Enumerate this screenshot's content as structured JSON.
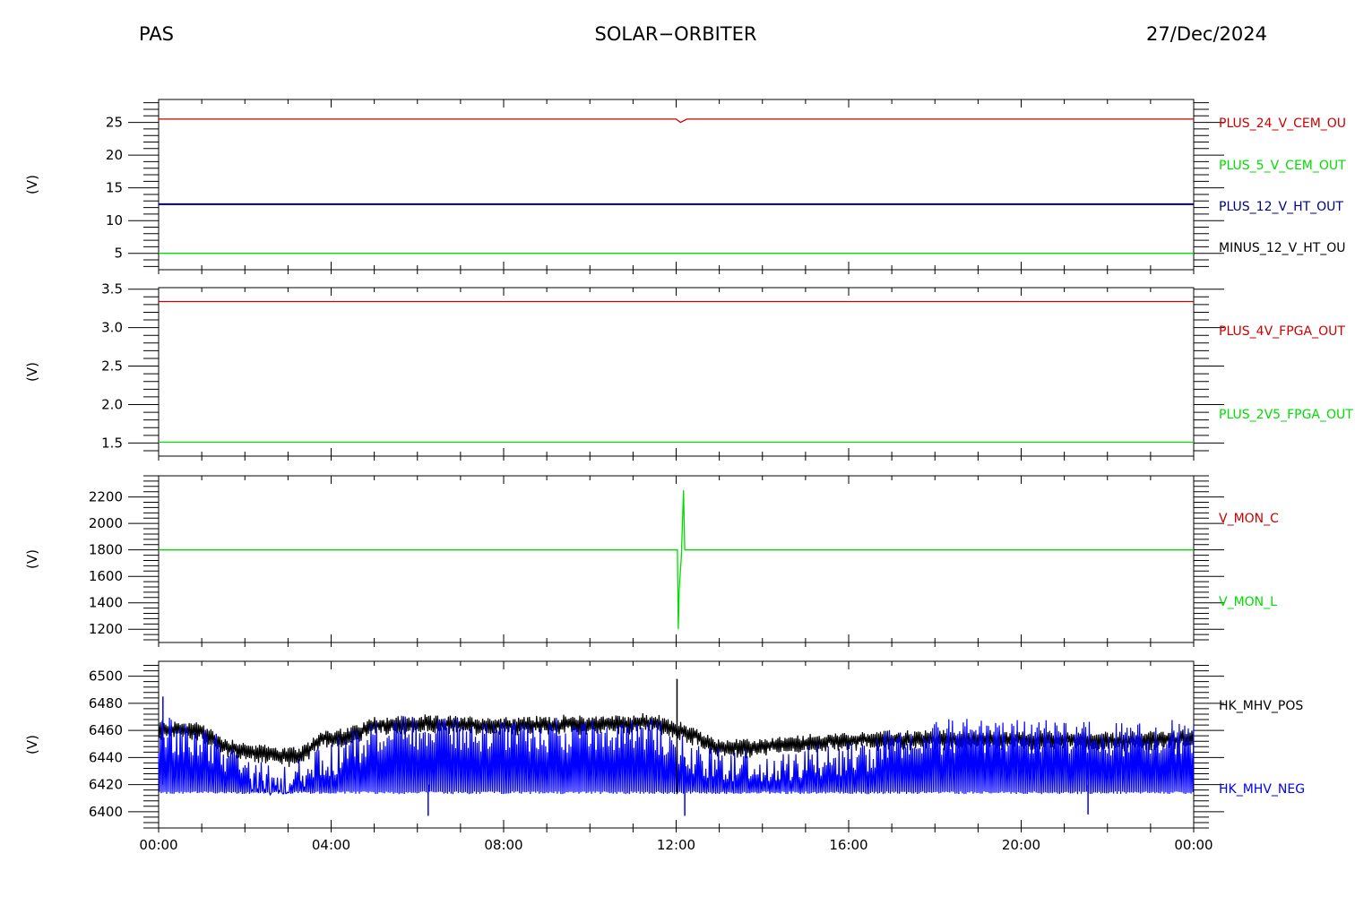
{
  "header": {
    "left": "PAS",
    "center": "SOLAR−ORBITER",
    "right": "27/Dec/2024"
  },
  "colors": {
    "red": "#cc0000",
    "green": "#00dd00",
    "navy": "#000080",
    "blue": "#0000ff",
    "black": "#000000"
  },
  "chart_data": [
    {
      "type": "line",
      "ylabel": "(V)",
      "ylim": [
        2.5,
        28.5
      ],
      "yticks": [
        5,
        10,
        15,
        20,
        25
      ],
      "yticklabels": [
        "5",
        "10",
        "15",
        "20",
        "25"
      ],
      "x_hours": [
        0,
        24
      ],
      "series": [
        {
          "name": "PLUS_24_V_CEM_OU",
          "color": "red",
          "x": [
            0,
            12.0,
            12.1,
            12.25,
            24
          ],
          "y": [
            25.5,
            25.5,
            25.0,
            25.5,
            25.5
          ]
        },
        {
          "name": "PLUS_5_V_CEM_OUT",
          "color": "green",
          "x": [
            0,
            24
          ],
          "y": [
            5.0,
            5.0
          ]
        },
        {
          "name": "PLUS_12_V_HT_OUT",
          "color": "navy",
          "x": [
            0,
            24
          ],
          "y": [
            12.5,
            12.5
          ]
        },
        {
          "name": "MINUS_12_V_HT_OU",
          "color": "black",
          "x": [],
          "y": []
        }
      ]
    },
    {
      "type": "line",
      "ylabel": "(V)",
      "ylim": [
        1.33,
        3.52
      ],
      "yticks": [
        1.5,
        2.0,
        2.5,
        3.0,
        3.5
      ],
      "yticklabels": [
        "1.5",
        "2.0",
        "2.5",
        "3.0",
        "3.5"
      ],
      "x_hours": [
        0,
        24
      ],
      "series": [
        {
          "name": "PLUS_4V_FPGA_OUT",
          "color": "red",
          "x": [
            0,
            24
          ],
          "y": [
            3.34,
            3.34
          ]
        },
        {
          "name": "PLUS_2V5_FPGA_OUT",
          "color": "green",
          "x": [
            0,
            24
          ],
          "y": [
            1.51,
            1.51
          ]
        }
      ]
    },
    {
      "type": "line",
      "ylabel": "(V)",
      "ylim": [
        1100,
        2360
      ],
      "yticks": [
        1200,
        1400,
        1600,
        1800,
        2000,
        2200
      ],
      "yticklabels": [
        "1200",
        "1400",
        "1600",
        "1800",
        "2000",
        "2200"
      ],
      "x_hours": [
        0,
        24
      ],
      "series": [
        {
          "name": "V_MON_C",
          "color": "red",
          "x": [],
          "y": []
        },
        {
          "name": "V_MON_L",
          "color": "green",
          "x": [
            0,
            12.03,
            12.05,
            12.07,
            12.12,
            12.17,
            12.2,
            24
          ],
          "y": [
            1800,
            1800,
            1200,
            1500,
            1750,
            2250,
            1800,
            1800
          ]
        }
      ]
    },
    {
      "type": "line",
      "ylabel": "(V)",
      "ylim": [
        6388,
        6511
      ],
      "yticks": [
        6400,
        6420,
        6440,
        6460,
        6480,
        6500
      ],
      "yticklabels": [
        "6400",
        "6420",
        "6440",
        "6460",
        "6480",
        "6500"
      ],
      "x_hours": [
        0,
        24
      ],
      "series": [
        {
          "name": "HK_MHV_POS",
          "color": "black",
          "level_hours": [
            0,
            1,
            1.5,
            2.2,
            3.3,
            3.8,
            4.3,
            5,
            6,
            8,
            10,
            11.5,
            12.4,
            12.8,
            13.5,
            16,
            18,
            20,
            22,
            24
          ],
          "level_vals": [
            6464,
            6463,
            6452,
            6447,
            6444,
            6458,
            6458,
            6467,
            6468,
            6467,
            6468,
            6469,
            6460,
            6452,
            6450,
            6456,
            6457,
            6457,
            6456,
            6457
          ]
        },
        {
          "name": "HK_MHV_NEG",
          "color": "blue",
          "low": 6413,
          "level_hours": [
            0,
            1,
            2,
            3,
            4,
            5,
            6,
            8,
            10,
            11.5,
            12.4,
            13,
            14,
            16,
            18,
            20,
            22,
            24
          ],
          "level_vals": [
            6468,
            6466,
            6440,
            6435,
            6450,
            6468,
            6470,
            6469,
            6469,
            6470,
            6452,
            6448,
            6445,
            6452,
            6468,
            6468,
            6466,
            6466
          ]
        }
      ]
    }
  ],
  "x_axis": {
    "tick_labels": [
      "00:00",
      "04:00",
      "08:00",
      "12:00",
      "16:00",
      "20:00",
      "00:00"
    ]
  }
}
